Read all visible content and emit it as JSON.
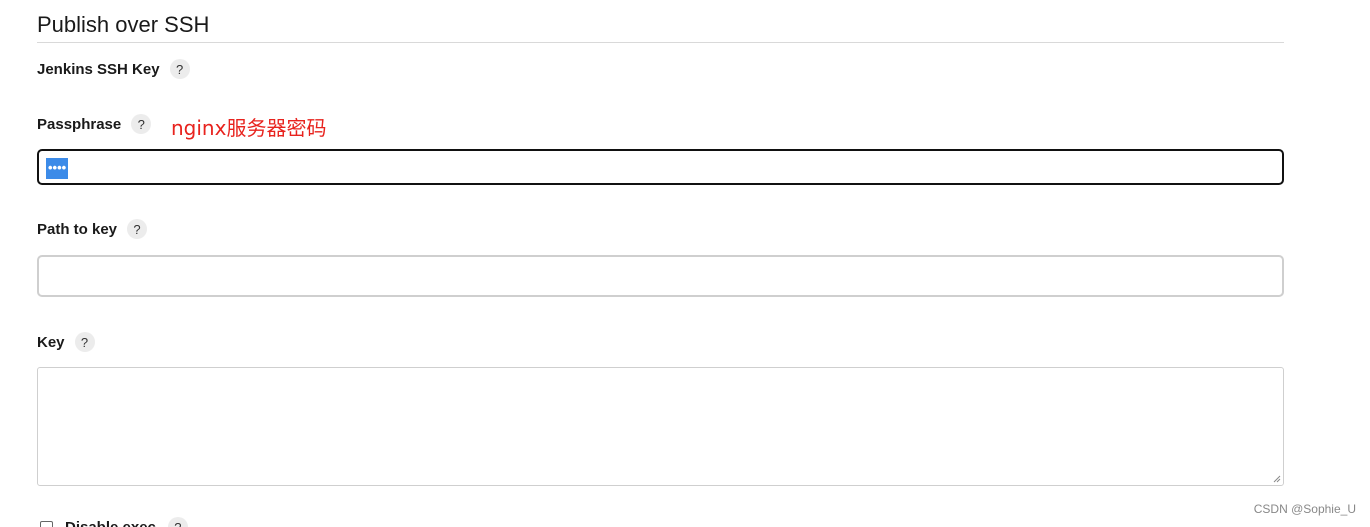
{
  "section": {
    "title": "Publish over SSH"
  },
  "fields": {
    "jenkins_ssh_key": {
      "label": "Jenkins SSH Key",
      "help": "?"
    },
    "passphrase": {
      "label": "Passphrase",
      "help": "?",
      "value_masked": "••••",
      "annotation": "nginx服务器密码"
    },
    "path_to_key": {
      "label": "Path to key",
      "help": "?",
      "value": ""
    },
    "key": {
      "label": "Key",
      "help": "?",
      "value": ""
    },
    "disable_exec": {
      "label": "Disable exec",
      "help": "?",
      "checked": false
    }
  },
  "watermark": "CSDN @Sophie_U",
  "colors": {
    "annotation": "#e8231e",
    "selection": "#3c8be8",
    "focus_border": "#111111",
    "input_border": "#cfcfcf"
  }
}
